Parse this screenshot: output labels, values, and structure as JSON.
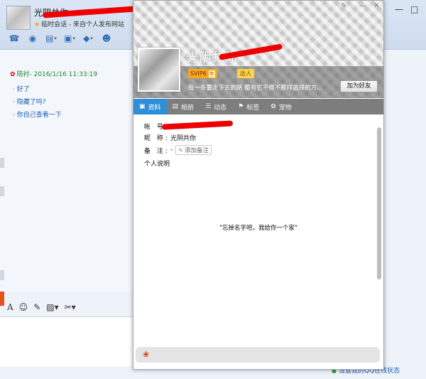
{
  "chat": {
    "name": "光阴共你",
    "subtitle": "临时会话 - 来自个人发布网站",
    "toolbar_icons": [
      "voice-call-icon",
      "video-call-icon",
      "send-file-icon",
      "screen-share-icon",
      "app-icon",
      "contacts-icon"
    ],
    "message": {
      "sender_time": "陪衬- 2016/1/16 11:33:19",
      "lines": [
        "好了",
        "隐藏了吗?",
        "你自己查看一下"
      ]
    },
    "input_toolbar_icons": [
      "font-icon",
      "emoji-icon",
      "edit-icon",
      "image-icon",
      "screenshot-icon"
    ],
    "status_link": "设置我的QQ在线状态"
  },
  "profile": {
    "nickname": "光阴共你",
    "badges": {
      "svip": "SVIP6",
      "year": "年",
      "daren": "达人"
    },
    "motto": "每一条要走下去的路 都有它不得不那样选择的方...",
    "add_friend_label": "加为好友",
    "tabs": [
      {
        "label": "资料",
        "icon": "profile-card-icon",
        "active": true
      },
      {
        "label": "相册",
        "icon": "photo-album-icon",
        "active": false
      },
      {
        "label": "动态",
        "icon": "feed-icon",
        "active": false
      },
      {
        "label": "标签",
        "icon": "tag-icon",
        "active": false
      },
      {
        "label": "宠物",
        "icon": "pet-icon",
        "active": false
      }
    ],
    "fields": {
      "account_label": "帐 号:",
      "nick_label": "昵 称:",
      "nick_value": "光阴共你",
      "remark_label": "备 注:",
      "remark_prefix": "-",
      "add_remark": "添加备注",
      "intro_label": "个人说明"
    },
    "intro": "\"忘掉名字吧，我给你一个家\""
  }
}
